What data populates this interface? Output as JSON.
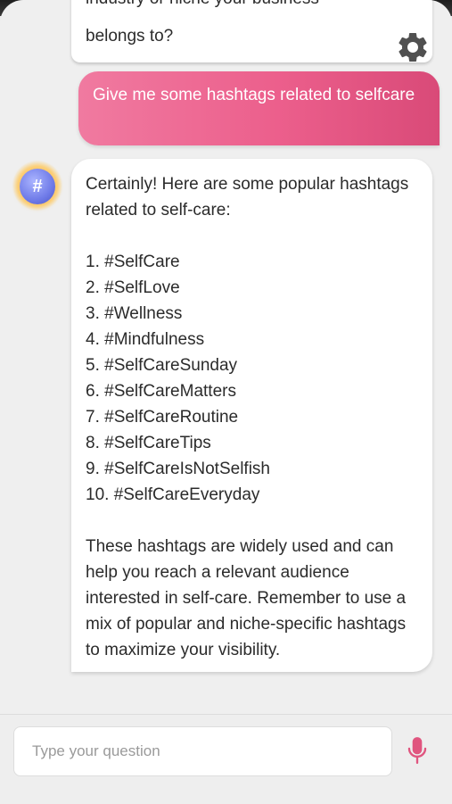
{
  "chat": {
    "previous_bot_fragment": "industry or niche your business",
    "previous_bot_tail": "belongs to?",
    "user_message": "Give me some hashtags related to selfcare",
    "bot_avatar_symbol": "#",
    "bot_intro": "Certainly! Here are some popular hashtags related to self-care:",
    "hashtags": [
      "1. #SelfCare",
      "2. #SelfLove",
      "3. #Wellness",
      "4. #Mindfulness",
      "5. #SelfCareSunday",
      "6. #SelfCareMatters",
      "7. #SelfCareRoutine",
      "8. #SelfCareTips",
      "9. #SelfCareIsNotSelfish",
      "10. #SelfCareEveryday"
    ],
    "bot_outro": "These hashtags are widely used and can help you reach a relevant audience interested in self-care. Remember to use a mix of popular and niche-specific hashtags to maximize your visibility."
  },
  "input": {
    "placeholder": "Type your question"
  },
  "icons": {
    "settings": "gear-icon",
    "microphone": "mic-icon",
    "avatar": "hashtag-avatar"
  },
  "colors": {
    "user_bubble_start": "#f07aa0",
    "user_bubble_end": "#d94a78",
    "mic": "#e0557f",
    "gear": "#505050"
  }
}
